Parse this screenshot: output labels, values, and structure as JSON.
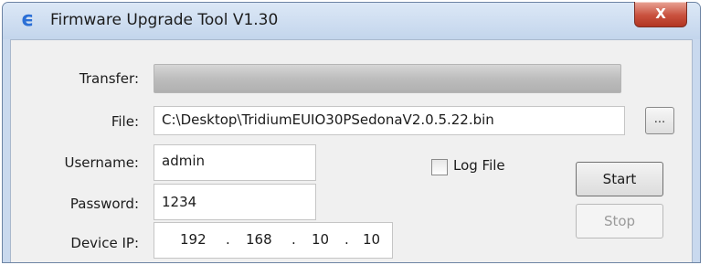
{
  "window": {
    "title": "Firmware Upgrade Tool V1.30",
    "close_label": "X"
  },
  "transfer": {
    "label": "Transfer:",
    "progress_fraction": 0.0
  },
  "file": {
    "label": "File:",
    "value": "C:\\Desktop\\TridiumEUIO30PSedonaV2.0.5.22.bin",
    "browse_label": "..."
  },
  "username": {
    "label": "Username:",
    "value": "admin"
  },
  "password": {
    "label": "Password:",
    "value": "1234"
  },
  "device_ip": {
    "label": "Device IP:",
    "octets": [
      "192",
      "168",
      "10",
      "10"
    ],
    "separator": "."
  },
  "log_file": {
    "label": "Log File",
    "checked": false
  },
  "buttons": {
    "start_label": "Start",
    "stop_label": "Stop"
  },
  "colors": {
    "title_bar": "#c9d9ee",
    "close_button": "#c9513e",
    "progress_track": "#bdbdbd",
    "disabled_text": "#9a9a9a"
  }
}
